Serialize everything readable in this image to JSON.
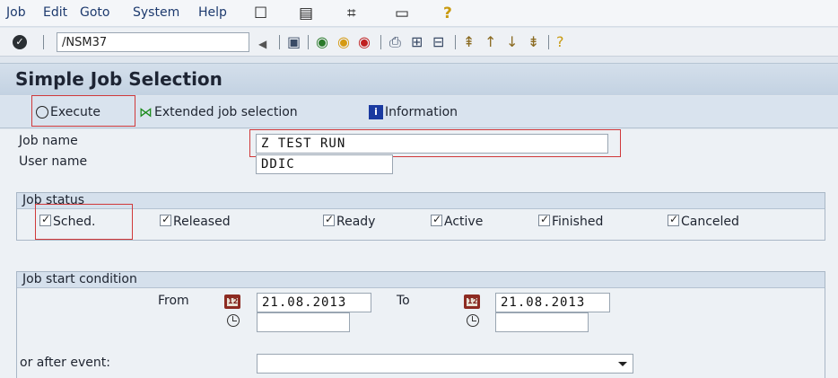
{
  "menu": {
    "items": [
      "Job",
      "Edit",
      "Goto",
      "System",
      "Help"
    ]
  },
  "system_toolbar": {
    "command_field_value": "/NSM37"
  },
  "screen": {
    "title": "Simple Job Selection"
  },
  "app_toolbar": {
    "execute_label": "Execute",
    "extended_label": "Extended job selection",
    "information_label": "Information"
  },
  "selection": {
    "job_name_label": "Job name",
    "job_name_value": "Z TEST RUN",
    "user_name_label": "User name",
    "user_name_value": "DDIC"
  },
  "job_status": {
    "title": "Job status",
    "options": [
      {
        "label": "Sched.",
        "checked": true
      },
      {
        "label": "Released",
        "checked": true
      },
      {
        "label": "Ready",
        "checked": true
      },
      {
        "label": "Active",
        "checked": true
      },
      {
        "label": "Finished",
        "checked": true
      },
      {
        "label": "Canceled",
        "checked": true
      }
    ]
  },
  "start_condition": {
    "title": "Job start condition",
    "from_label": "From",
    "from_date": "21.08.2013",
    "from_time": "",
    "to_label": "To",
    "to_date": "21.08.2013",
    "to_time": "",
    "event_label": "or after event:",
    "event_value": ""
  },
  "colors": {
    "highlight": "#d0393a",
    "menu_text": "#1d3a6e",
    "title_bar": "#c3d2e2"
  }
}
